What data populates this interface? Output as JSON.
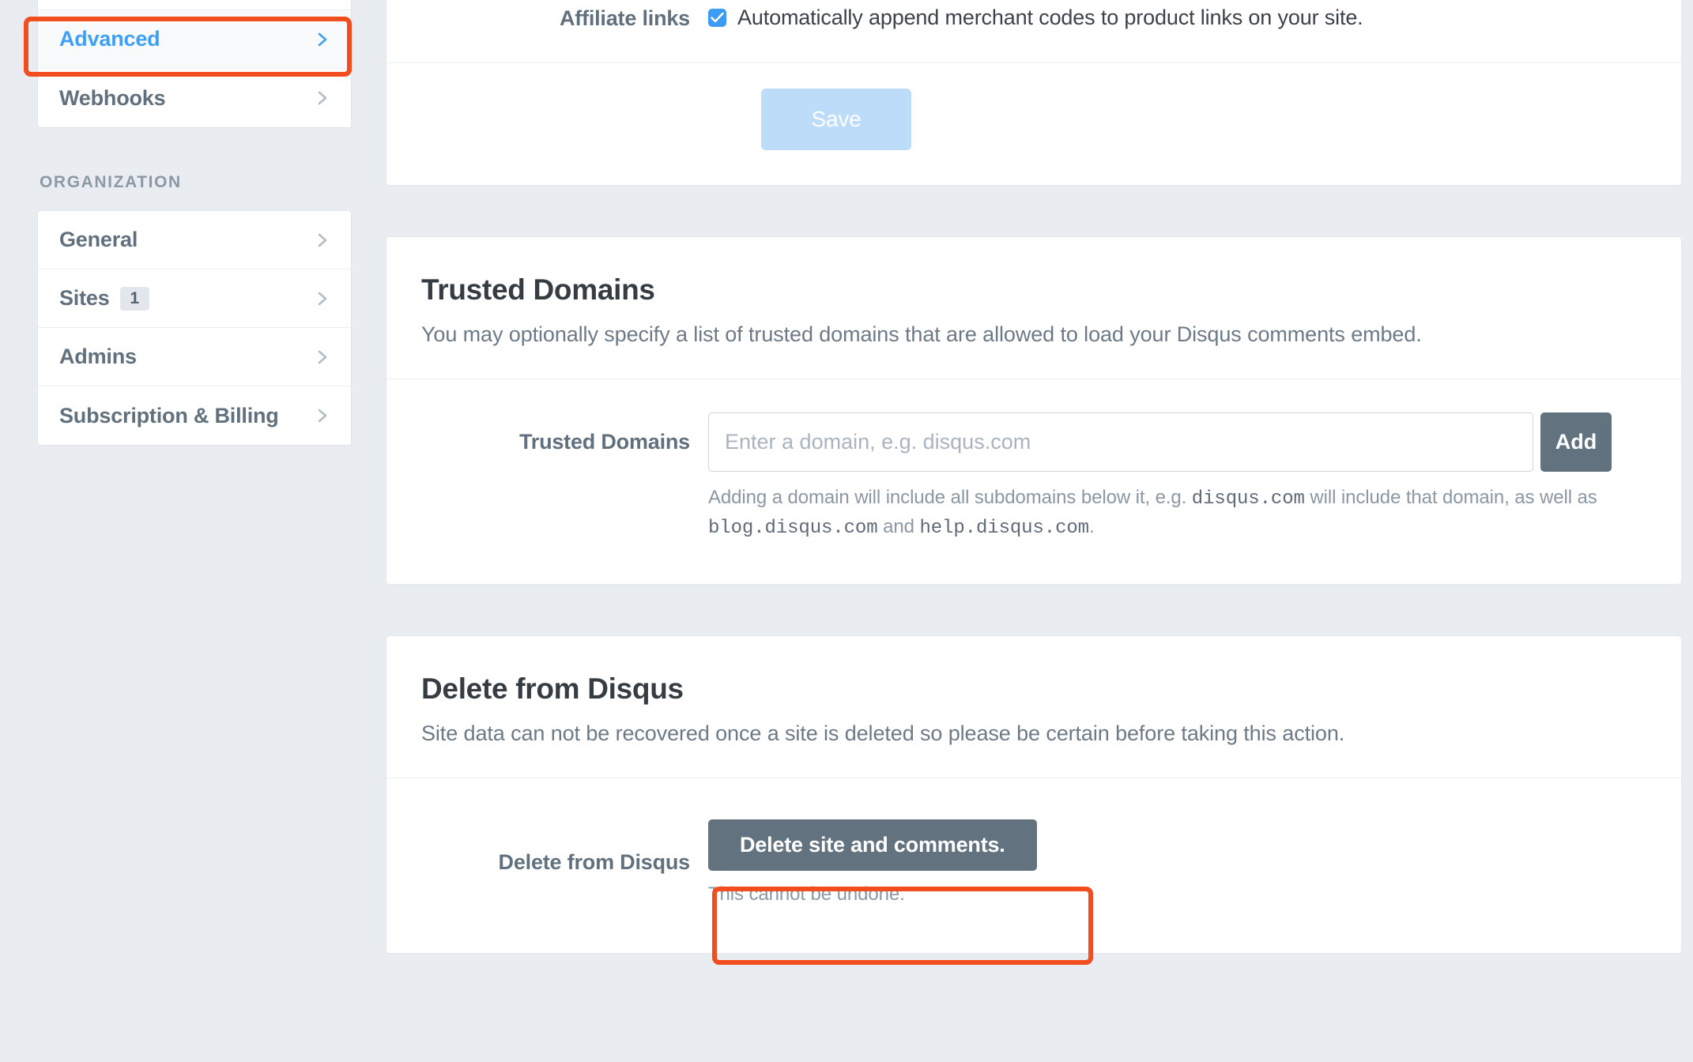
{
  "sidebar": {
    "nav_primary": [
      {
        "label": "Advanced",
        "active": true,
        "icon": "chevron-right-icon"
      },
      {
        "label": "Webhooks",
        "active": false,
        "icon": "chevron-right-icon"
      }
    ],
    "organization_heading": "ORGANIZATION",
    "nav_organization": [
      {
        "label": "General",
        "badge": "",
        "icon": "chevron-right-icon"
      },
      {
        "label": "Sites",
        "badge": "1",
        "icon": "chevron-right-icon"
      },
      {
        "label": "Admins",
        "badge": "",
        "icon": "chevron-right-icon"
      },
      {
        "label": "Subscription & Billing",
        "badge": "",
        "icon": "chevron-right-icon"
      }
    ]
  },
  "affiliate": {
    "label": "Affiliate links",
    "checkbox_label": "Automatically append merchant codes to product links on your site.",
    "checked": true,
    "save_label": "Save"
  },
  "trusted_domains": {
    "title": "Trusted Domains",
    "description": "You may optionally specify a list of trusted domains that are allowed to load your Disqus comments embed.",
    "field_label": "Trusted Domains",
    "input_value": "",
    "input_placeholder": "Enter a domain, e.g. disqus.com",
    "add_label": "Add",
    "help_part1": "Adding a domain will include all subdomains below it, e.g.",
    "help_code1": "disqus.com",
    "help_part2": "will include that domain, as well as",
    "help_code2": "blog.disqus.com",
    "help_part3": "and",
    "help_code3": "help.disqus.com",
    "help_part4": "."
  },
  "delete_section": {
    "title": "Delete from Disqus",
    "description": "Site data can not be recovered once a site is deleted so please be certain before taking this action.",
    "field_label": "Delete from Disqus",
    "button_label": "Delete site and comments.",
    "note": "This cannot be undone."
  },
  "colors": {
    "highlight": "#f24d1e",
    "accent_blue": "#3da0f5",
    "button_gray": "#62737f",
    "save_disabled": "#bcdcfa",
    "page_bg": "#e9edf2"
  }
}
